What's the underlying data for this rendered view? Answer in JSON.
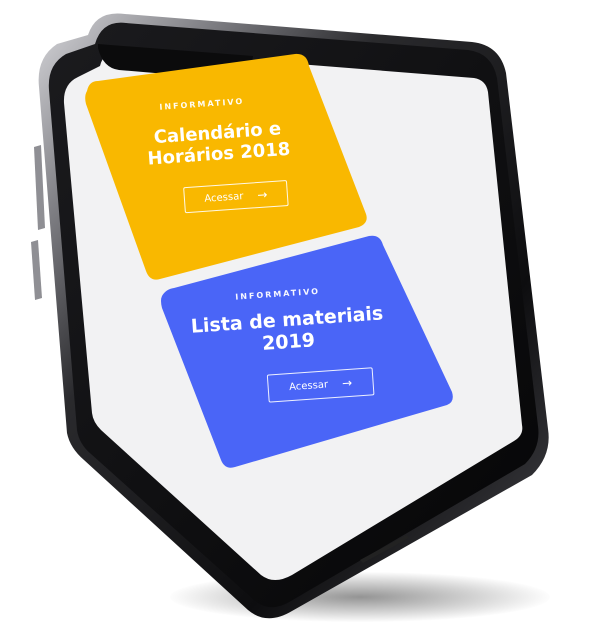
{
  "cards": [
    {
      "eyebrow": "INFORMATIVO",
      "title_line1": "Calendário e",
      "title_line2": "Horários 2018",
      "button_label": "Acessar",
      "color": "#F9B800"
    },
    {
      "eyebrow": "INFORMATIVO",
      "title_line1": "Lista de materiais",
      "title_line2": "2019",
      "button_label": "Acessar",
      "color": "#4A65F7"
    }
  ],
  "colors": {
    "screen": "#F2F2F3",
    "phone_body": "#111111",
    "frame_highlight": "#B8B8BC"
  },
  "icons": [
    "arrow-right-icon"
  ]
}
